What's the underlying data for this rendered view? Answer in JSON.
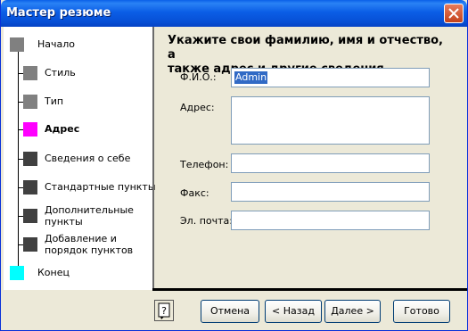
{
  "window": {
    "title": "Мастер резюме"
  },
  "steps": [
    {
      "label": "Начало",
      "color": "#808080",
      "state": "done"
    },
    {
      "label": "Стиль",
      "color": "#808080",
      "state": "done"
    },
    {
      "label": "Тип",
      "color": "#808080",
      "state": "done"
    },
    {
      "label": "Адрес",
      "color": "#ff00ff",
      "state": "current"
    },
    {
      "label": "Сведения о себе",
      "color": "#404040",
      "state": "pending"
    },
    {
      "label": "Стандартные пункты",
      "color": "#404040",
      "state": "pending"
    },
    {
      "label": "Дополнительные пункты",
      "line1": "Дополнительные",
      "line2": "пункты",
      "color": "#404040",
      "state": "pending"
    },
    {
      "label": "Добавление и порядок пунктов",
      "line1": "Добавление и",
      "line2": "порядок пунктов",
      "color": "#404040",
      "state": "pending"
    },
    {
      "label": "Конец",
      "color": "#00ffff",
      "state": "pending"
    }
  ],
  "main": {
    "heading_line1": "Укажите свои фамилию, имя и отчество, а",
    "heading_line2": "также адрес и другие сведения."
  },
  "form": {
    "fio": {
      "label": "Ф.И.О.:",
      "value": "Admin"
    },
    "address": {
      "label": "Адрес:",
      "value": ""
    },
    "phone": {
      "label": "Телефон:",
      "value": ""
    },
    "fax": {
      "label": "Факс:",
      "value": ""
    },
    "email": {
      "label": "Эл. почта:",
      "value": ""
    }
  },
  "buttons": {
    "help": "?",
    "cancel": "Отмена",
    "back": "< Назад",
    "next": "Далее >",
    "finish": "Готово"
  }
}
